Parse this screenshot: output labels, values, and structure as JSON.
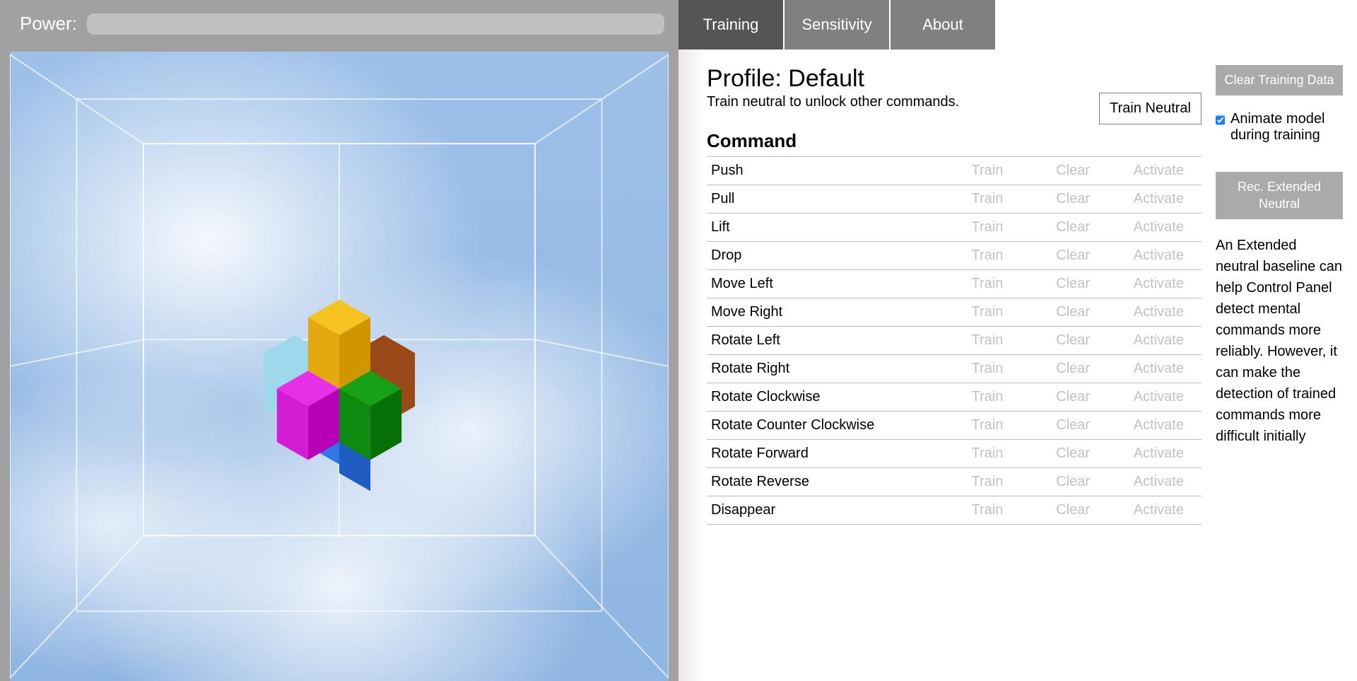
{
  "power": {
    "label": "Power:"
  },
  "tabs": [
    {
      "label": "Training",
      "active": true
    },
    {
      "label": "Sensitivity",
      "active": false
    },
    {
      "label": "About",
      "active": false
    }
  ],
  "profile": {
    "title": "Profile: Default",
    "subtitle": "Train neutral to unlock other commands.",
    "train_neutral": "Train Neutral"
  },
  "command_header": "Command",
  "action_labels": {
    "train": "Train",
    "clear": "Clear",
    "activate": "Activate"
  },
  "commands": [
    {
      "name": "Push"
    },
    {
      "name": "Pull"
    },
    {
      "name": "Lift"
    },
    {
      "name": "Drop"
    },
    {
      "name": "Move Left"
    },
    {
      "name": "Move Right"
    },
    {
      "name": "Rotate Left"
    },
    {
      "name": "Rotate Right"
    },
    {
      "name": "Rotate Clockwise"
    },
    {
      "name": "Rotate Counter Clockwise"
    },
    {
      "name": "Rotate Forward"
    },
    {
      "name": "Rotate Reverse"
    },
    {
      "name": "Disappear"
    }
  ],
  "side": {
    "clear_training": "Clear Training Data",
    "animate_label": "Animate model during training",
    "animate_checked": true,
    "rec_extended": "Rec. Extended Neutral",
    "extended_desc": "An Extended neutral baseline can help Control Panel detect mental commands more reliably. However, it can make the detection of trained commands more difficult initially"
  },
  "cube_colors": {
    "yellow_top": "#f6c421",
    "yellow_left": "#e3a90f",
    "yellow_right": "#d09600",
    "magenta_top": "#e72fe7",
    "magenta_left": "#d41cd4",
    "magenta_right": "#b800b8",
    "green_top": "#17a117",
    "green_left": "#0e8a0e",
    "green_right": "#067006",
    "lightblue": "#9ed8ed",
    "brown": "#9a4a18",
    "blue_top": "#2f77e6",
    "blue_right": "#1f5dc2"
  }
}
